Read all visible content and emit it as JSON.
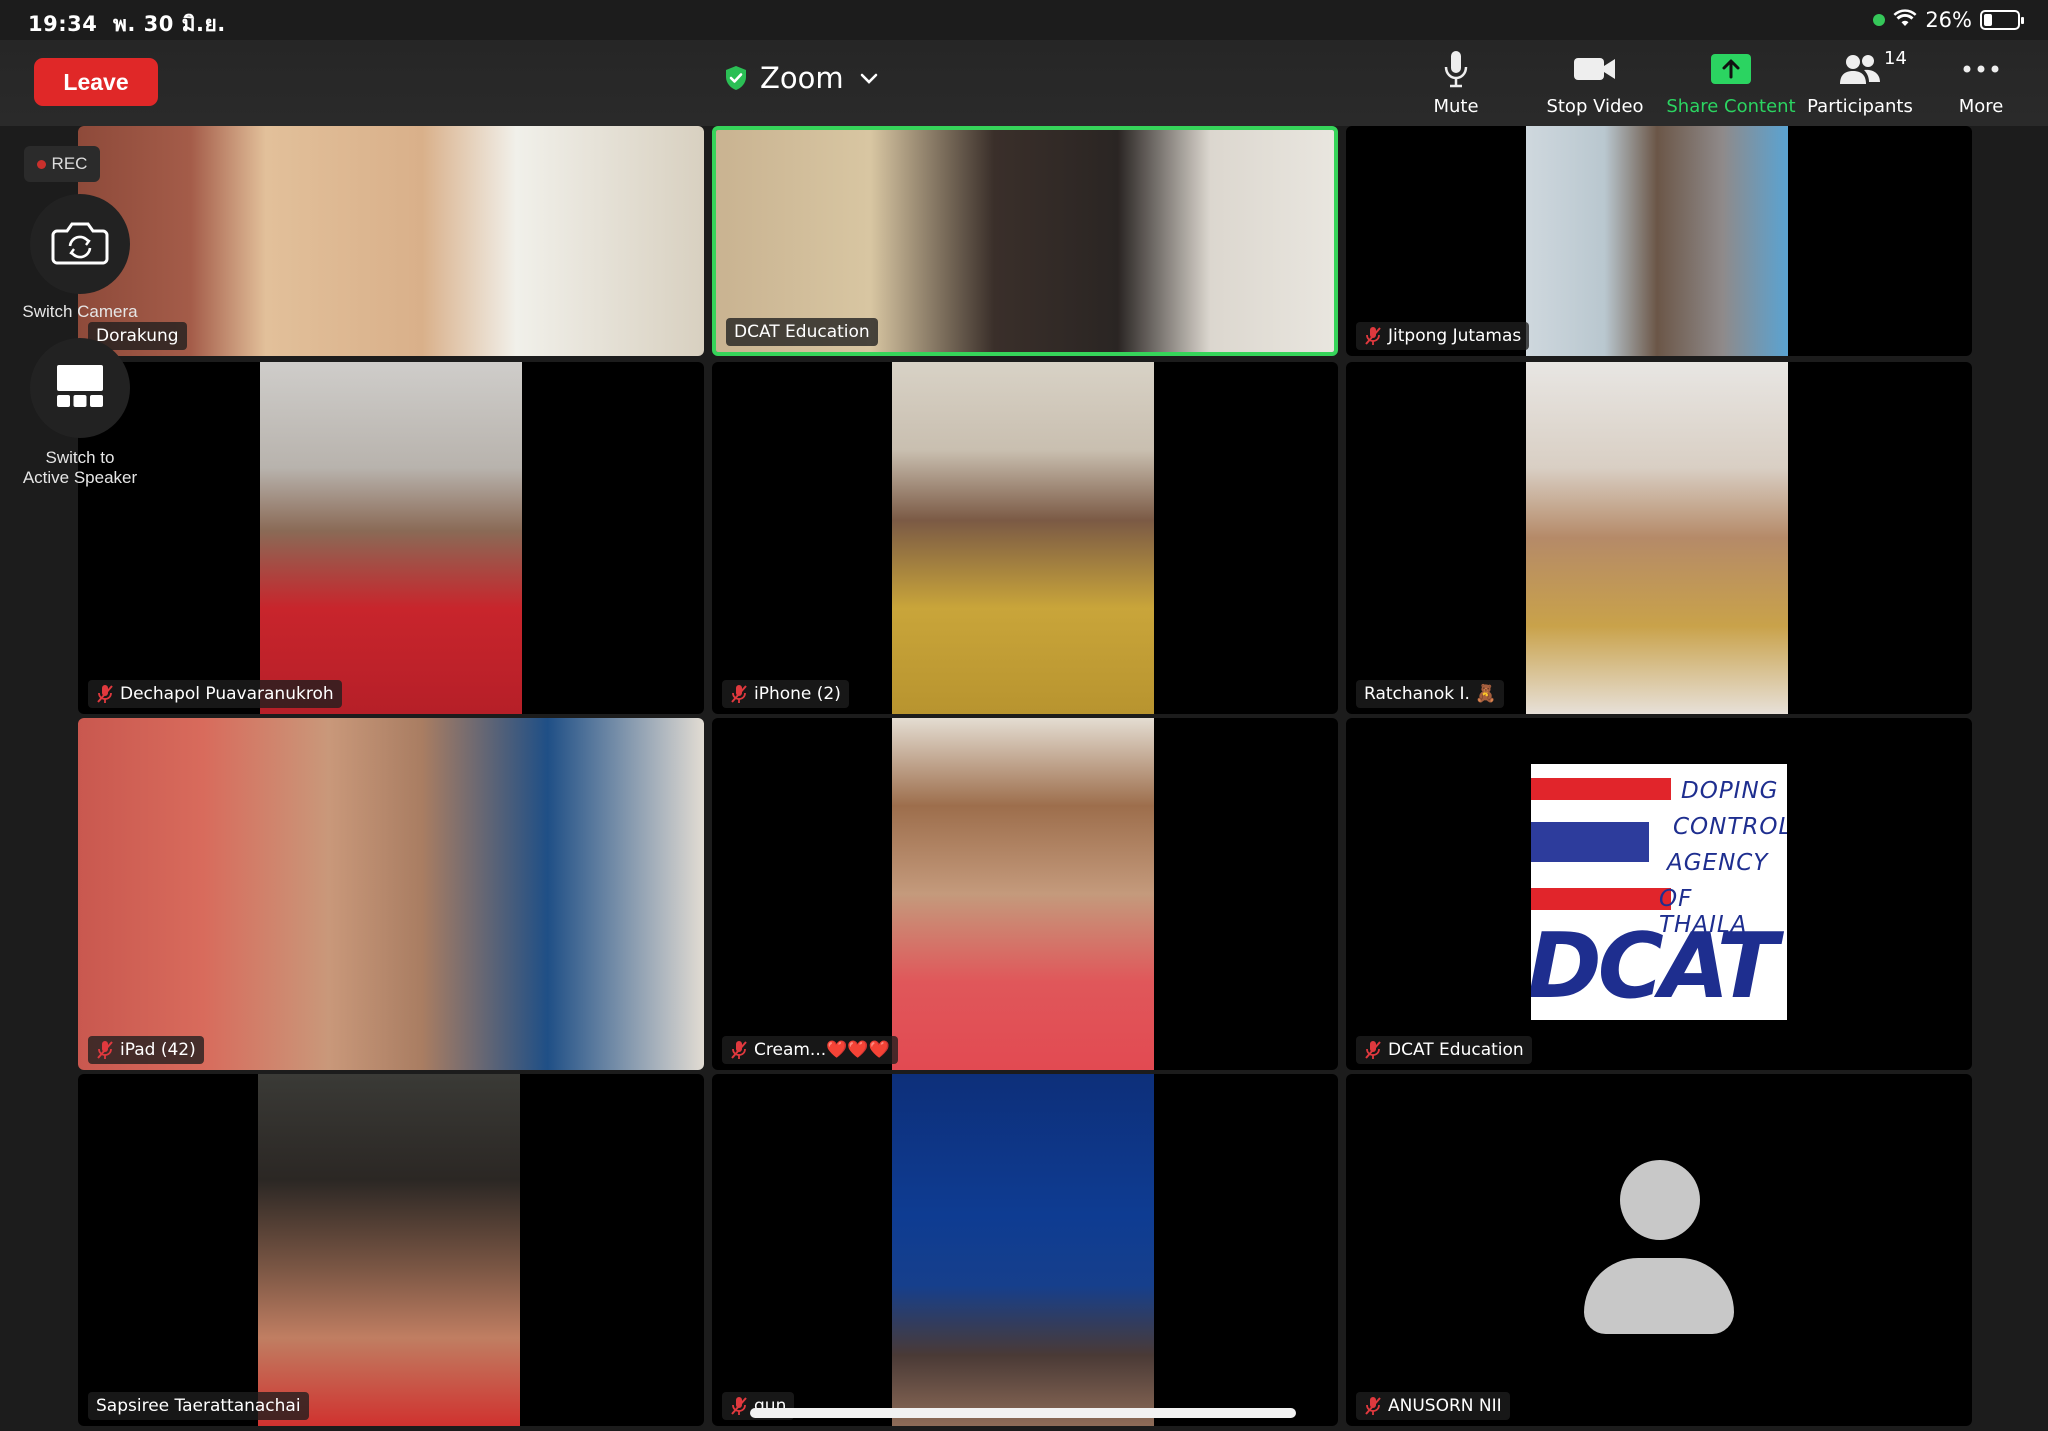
{
  "status_bar": {
    "time": "19:34",
    "date": "พ. 30 มิ.ย.",
    "battery": "26%",
    "battery_level": 0.26
  },
  "toolbar": {
    "leave_label": "Leave",
    "meeting_title": "Zoom",
    "mute_label": "Mute",
    "stop_video_label": "Stop Video",
    "share_label": "Share Content",
    "participants_label": "Participants",
    "participants_count": "14",
    "more_label": "More"
  },
  "side": {
    "rec_label": "REC",
    "switch_camera_label": "Switch Camera",
    "switch_speaker_label_1": "Switch to",
    "switch_speaker_label_2": "Active Speaker"
  },
  "tiles": [
    {
      "name": "Dorakung",
      "muted": false
    },
    {
      "name": "DCAT Education",
      "muted": false
    },
    {
      "name": "Jitpong Jutamas",
      "muted": true
    },
    {
      "name": "Dechapol Puavaranukroh",
      "muted": true
    },
    {
      "name": "iPhone (2)",
      "muted": true
    },
    {
      "name": "Ratchanok I. 🧸",
      "muted": false
    },
    {
      "name": "iPad (42)",
      "muted": true
    },
    {
      "name": "Cream...❤️❤️❤️",
      "muted": true
    },
    {
      "name": "DCAT Education",
      "muted": true
    },
    {
      "name": "Sapsiree Taerattanachai",
      "muted": false
    },
    {
      "name": "gun",
      "muted": true
    },
    {
      "name": "ANUSORN NII",
      "muted": true
    }
  ],
  "logo": {
    "line1": "DOPING",
    "line2": "CONTROL",
    "line3": "AGENCY",
    "line4": "OF THAILA",
    "big": "DCAT"
  },
  "colors": {
    "leave": "#e02828",
    "share": "#2bd461",
    "active_border": "#36d45a",
    "muted_icon": "#e0393e"
  }
}
